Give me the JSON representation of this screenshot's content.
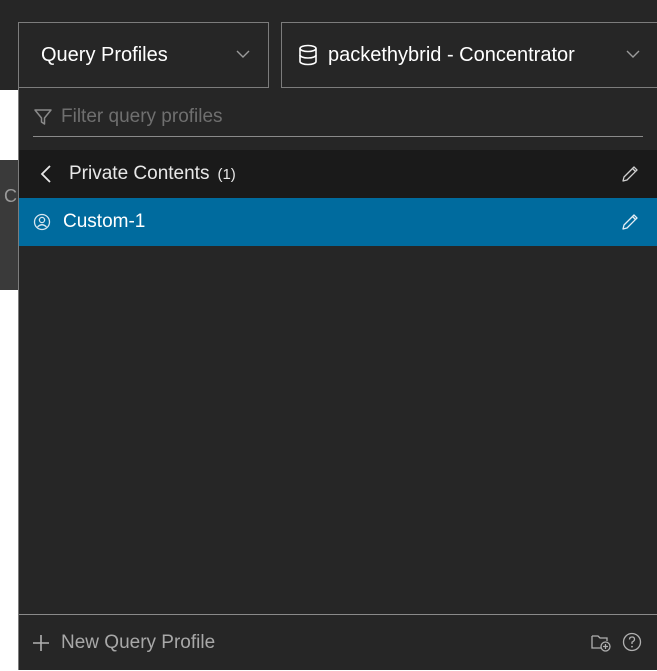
{
  "query_profiles_dropdown": {
    "label": "Query Profiles"
  },
  "service_dropdown": {
    "label": "packethybrid - Concentrator"
  },
  "filter": {
    "placeholder": "Filter query profiles"
  },
  "folder": {
    "name": "Private Contents",
    "count": "(1)"
  },
  "profiles": [
    {
      "name": "Custom-1"
    }
  ],
  "footer": {
    "new_label": "New Query Profile"
  },
  "background": {
    "letter": "C"
  },
  "colors": {
    "panel_bg": "#262626",
    "selected_bg": "#006b9e",
    "header_bg": "#1a1a1a"
  }
}
